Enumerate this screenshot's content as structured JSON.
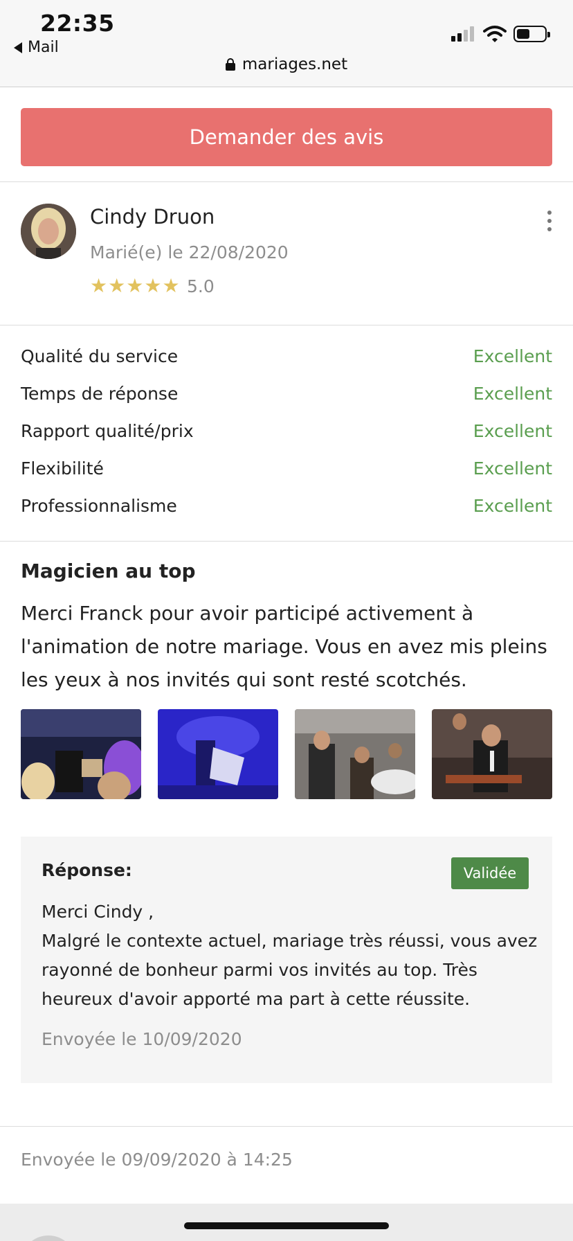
{
  "status_bar": {
    "time": "22:35",
    "back_label": "Mail",
    "url": "mariages.net",
    "icons": [
      "lock-icon",
      "signal-icon",
      "wifi-icon",
      "battery-icon"
    ]
  },
  "actions": {
    "request_reviews": "Demander des avis"
  },
  "review": {
    "reviewer_name": "Cindy Druon",
    "married_date": "Marié(e) le 22/08/2020",
    "rating_stars": 5,
    "rating_value": "5.0",
    "criteria": [
      {
        "label": "Qualité du service",
        "grade": "Excellent"
      },
      {
        "label": "Temps de réponse",
        "grade": "Excellent"
      },
      {
        "label": "Rapport qualité/prix",
        "grade": "Excellent"
      },
      {
        "label": "Flexibilité",
        "grade": "Excellent"
      },
      {
        "label": "Professionnalisme",
        "grade": "Excellent"
      }
    ],
    "title": "Magicien au top",
    "text_lines": [
      "Merci Franck pour avoir participé activement à",
      "l'animation de notre mariage. Vous en avez mis pleins",
      "les yeux à nos invités qui sont resté scotchés."
    ],
    "photos": [
      "magician-stage-photo",
      "magician-blue-light-photo",
      "magician-guests-photo",
      "magician-table-photo"
    ]
  },
  "answer": {
    "label": "Réponse:",
    "status": "Validée",
    "lines": [
      "Merci Cindy ,",
      "Malgré le contexte actuel, mariage très réussi, vous avez",
      "rayonné de bonheur parmi vos invités au top. Très",
      "heureux d'avoir apporté ma part à cette réussite."
    ],
    "sent_date": "Envoyée le 10/09/2020"
  },
  "sent_date": "Envoyée le 09/09/2020 à 14:25",
  "colors": {
    "accent_button": "#e8716f",
    "grade_green": "#5a9e4f",
    "badge_green": "#4e8a48",
    "star_gold": "#e2c25e"
  }
}
